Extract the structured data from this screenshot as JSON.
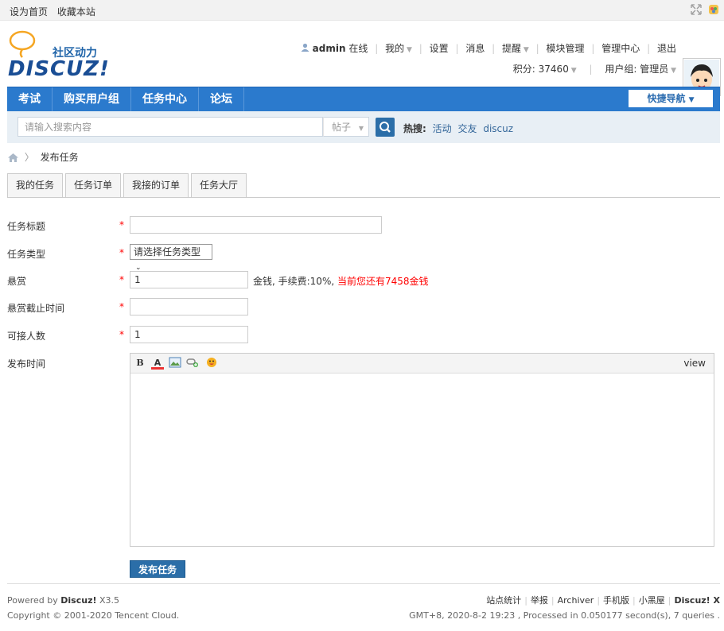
{
  "topbar": {
    "set_home": "设为首页",
    "favorite": "收藏本站"
  },
  "logo": {
    "tagline": "社区动力",
    "brand": "DISCUZ!"
  },
  "user": {
    "name": "admin",
    "status": "在线",
    "menu": [
      "我的",
      "设置",
      "消息",
      "提醒",
      "模块管理",
      "管理中心",
      "退出"
    ],
    "credits": "积分: 37460",
    "group": "用户组: 管理员"
  },
  "nav": {
    "items": [
      "考试",
      "购买用户组",
      "任务中心",
      "论坛"
    ],
    "quick_nav": "快捷导航"
  },
  "search": {
    "placeholder": "请输入搜索内容",
    "type": "帖子",
    "hot_label": "热搜:",
    "hot_words": [
      "活动",
      "交友",
      "discuz"
    ]
  },
  "breadcrumb": {
    "current": "发布任务"
  },
  "tabs": [
    "我的任务",
    "任务订单",
    "我接的订单",
    "任务大厅"
  ],
  "form": {
    "title_label": "任务标题",
    "type_label": "任务类型",
    "type_select": "请选择任务类型",
    "reward_label": "悬赏",
    "reward_value": "1",
    "reward_hint": "金钱, 手续费:10%,",
    "reward_hint_red": "当前您还有7458金钱",
    "deadline_label": "悬赏截止时间",
    "people_label": "可接人数",
    "people_value": "1",
    "publish_time_label": "发布时间",
    "required_mark": "*",
    "editor_view": "view",
    "editor_bold": "B",
    "editor_color": "A",
    "submit_label": "发布任务"
  },
  "footer": {
    "powered_prefix": "Powered by",
    "powered_brand": "Discuz!",
    "powered_version": "X3.5",
    "copyright": "Copyright © 2001-2020 Tencent Cloud.",
    "links": [
      "站点统计",
      "举报",
      "Archiver",
      "手机版",
      "小黑屋",
      "Discuz! X"
    ],
    "stats": "GMT+8, 2020-8-2 19:23 , Processed in 0.050177 second(s), 7 queries ."
  }
}
